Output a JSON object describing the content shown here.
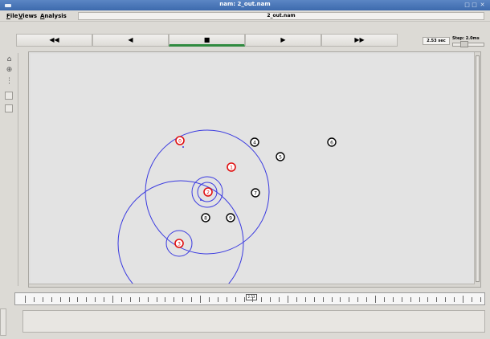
{
  "window": {
    "title": "nam: 2_out.nam",
    "controls": {
      "menu": "menu-icon",
      "minimize": "□",
      "maximize": "□",
      "close": "✕"
    }
  },
  "menubar": {
    "file": {
      "first": "F",
      "rest": "ile"
    },
    "views": {
      "first": "V",
      "rest": "iews"
    },
    "analysis": {
      "first": "A",
      "rest": "nalysis"
    },
    "file_label": "2_out.nam"
  },
  "controls": {
    "rewind": "◀◀",
    "back": "◀",
    "stop": "■",
    "play": "▶",
    "fastforward": "▶▶",
    "time_display": "2.53 sec",
    "step_label": "Step: 2.0ms"
  },
  "tools": [
    "zoom-in-icon",
    "zoom-out-icon",
    "layout-icon",
    "edit-box",
    "blank-box"
  ],
  "timeline": {
    "marker_label": "2.53"
  },
  "canvas": {
    "node_colors": {
      "red": "#e01010",
      "black": "#000000",
      "circle": "#3a3ae0"
    },
    "nodes": [
      {
        "id": "0",
        "color": "red"
      },
      {
        "id": "1",
        "color": "red"
      },
      {
        "id": "2",
        "color": "red"
      },
      {
        "id": "3",
        "color": "red"
      },
      {
        "id": "4",
        "color": "black"
      },
      {
        "id": "5",
        "color": "black"
      },
      {
        "id": "6",
        "color": "black"
      },
      {
        "id": "7",
        "color": "black"
      },
      {
        "id": "8",
        "color": "black"
      },
      {
        "id": "9",
        "color": "black"
      }
    ]
  }
}
